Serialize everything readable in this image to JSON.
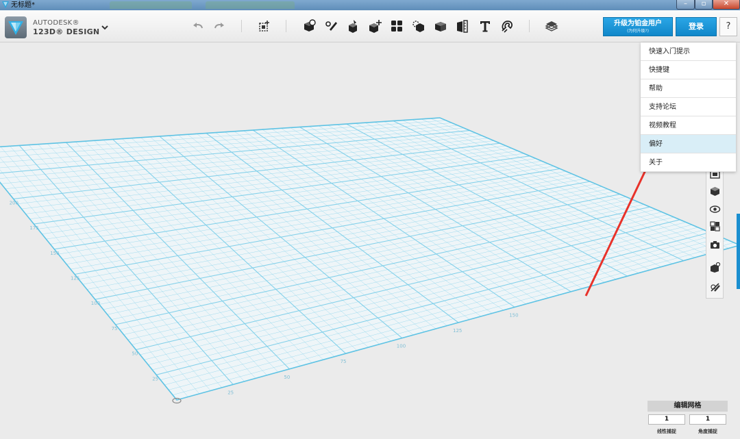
{
  "window": {
    "title": "无标题*",
    "min_icon": "minimize-icon",
    "max_icon": "maximize-icon",
    "close_icon": "close-icon"
  },
  "app": {
    "brand_line1": "AUTODESK®",
    "brand_line2": "123D® DESIGN"
  },
  "toolbar": {
    "tools": [
      "undo-icon",
      "redo-icon",
      "transform-icon",
      "primitives-icon",
      "sketch-icon",
      "construct-icon",
      "modify-icon",
      "pattern-icon",
      "grouping-icon",
      "combine-icon",
      "measure-icon",
      "text-icon",
      "snap-icon",
      "material-icon"
    ],
    "upgrade_label": "升级为铂金用户",
    "upgrade_sub": "(为何升级?)",
    "login_label": "登录",
    "help_label": "?"
  },
  "help_menu": {
    "items": [
      "快速入门提示",
      "快捷键",
      "帮助",
      "支持论坛",
      "视频教程",
      "偏好",
      "关于"
    ],
    "active_index": 5
  },
  "grid": {
    "x_ticks": [
      "25",
      "50",
      "75",
      "100",
      "125",
      "150"
    ],
    "y_ticks": [
      "25",
      "50",
      "75",
      "100",
      "125",
      "150",
      "175",
      "200",
      "225",
      "250"
    ]
  },
  "side_panel": {
    "icons": [
      "fit-view-icon",
      "view-cube-icon",
      "visibility-icon",
      "material-palette-icon",
      "camera-icon",
      "component-icon",
      "hide-sketch-icon"
    ]
  },
  "grid_settings": {
    "title": "编辑网格",
    "linear_snap_value": "1",
    "angle_snap_value": "1",
    "linear_snap_label": "线性捕捉",
    "angle_snap_label": "角度捕捉"
  },
  "colors": {
    "grid_line": "#7fd0ea",
    "accent_blue": "#1a8fd0",
    "annotation_arrow": "#e8322a"
  }
}
